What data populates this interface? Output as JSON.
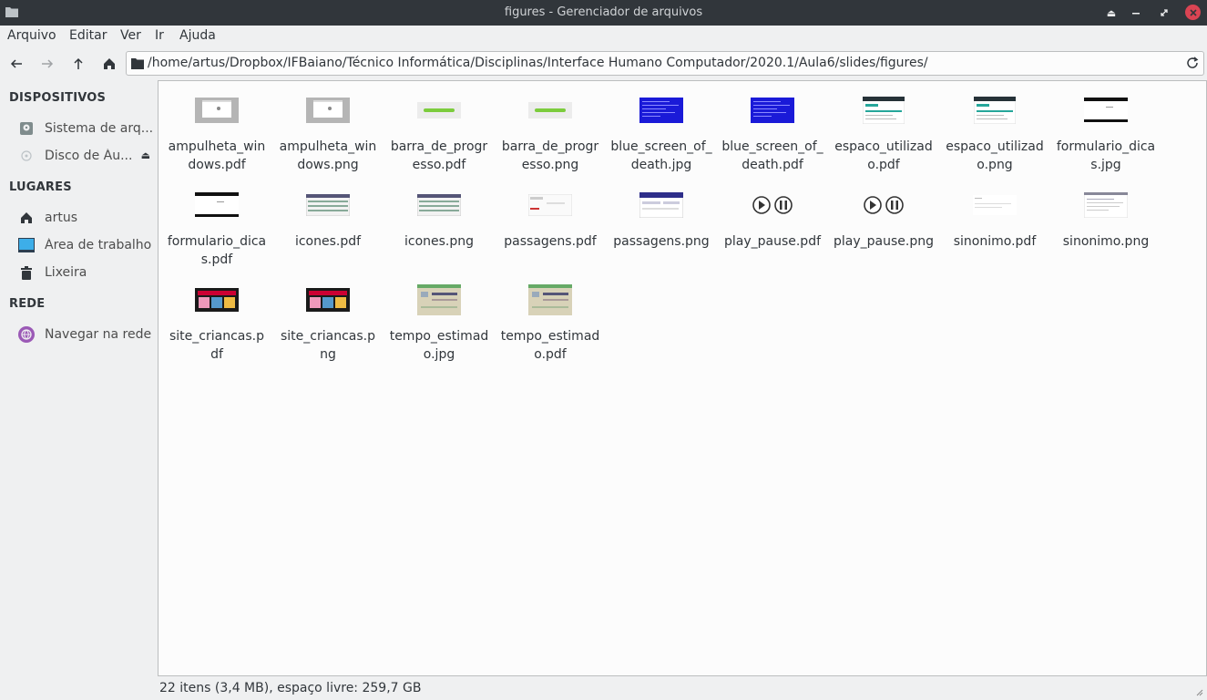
{
  "window": {
    "title": "figures - Gerenciador de arquivos",
    "controls": [
      "eject-icon",
      "minimize-icon",
      "maximize-icon",
      "close-icon"
    ]
  },
  "menubar": {
    "items": [
      "Arquivo",
      "Editar",
      "Ver",
      "Ir",
      "Ajuda"
    ]
  },
  "toolbar": {
    "buttons": [
      "back-arrow-icon",
      "forward-arrow-icon",
      "up-arrow-icon",
      "home-icon"
    ],
    "path": "/home/artus/Dropbox/IFBaiano/Técnico Informática/Disciplinas/Interface Humano Computador/2020.1/Aula6/slides/figures/"
  },
  "sidebar": {
    "sections": [
      {
        "title": "DISPOSITIVOS",
        "items": [
          {
            "label": "Sistema de arq...",
            "icon": "harddisk-icon"
          },
          {
            "label": "Disco de Áu...",
            "icon": "optical-disc-icon",
            "eject": true
          }
        ]
      },
      {
        "title": "LUGARES",
        "items": [
          {
            "label": "artus",
            "icon": "home-icon"
          },
          {
            "label": "Área de trabalho",
            "icon": "desktop-icon"
          },
          {
            "label": "Lixeira",
            "icon": "trash-icon"
          }
        ]
      },
      {
        "title": "REDE",
        "items": [
          {
            "label": "Navegar na rede",
            "icon": "network-icon"
          }
        ]
      }
    ]
  },
  "files": [
    {
      "name": "ampulheta_windows.pdf",
      "thumb": "hourglass"
    },
    {
      "name": "ampulheta_windows.png",
      "thumb": "hourglass"
    },
    {
      "name": "barra_de_progresso.pdf",
      "thumb": "progress"
    },
    {
      "name": "barra_de_progresso.png",
      "thumb": "progress"
    },
    {
      "name": "blue_screen_of_death.jpg",
      "thumb": "bsod"
    },
    {
      "name": "blue_screen_of_death.pdf",
      "thumb": "bsod"
    },
    {
      "name": "espaco_utilizado.pdf",
      "thumb": "storage"
    },
    {
      "name": "espaco_utilizado.png",
      "thumb": "storage"
    },
    {
      "name": "formulario_dicas.jpg",
      "thumb": "form"
    },
    {
      "name": "formulario_dicas.pdf",
      "thumb": "form"
    },
    {
      "name": "icones.pdf",
      "thumb": "icons"
    },
    {
      "name": "icones.png",
      "thumb": "icons"
    },
    {
      "name": "passagens.pdf",
      "thumb": "tickets-light"
    },
    {
      "name": "passagens.png",
      "thumb": "tickets"
    },
    {
      "name": "play_pause.pdf",
      "thumb": "playpause"
    },
    {
      "name": "play_pause.png",
      "thumb": "playpause"
    },
    {
      "name": "sinonimo.pdf",
      "thumb": "synonym-light"
    },
    {
      "name": "sinonimo.png",
      "thumb": "synonym"
    },
    {
      "name": "site_criancas.pdf",
      "thumb": "kids"
    },
    {
      "name": "site_criancas.png",
      "thumb": "kids"
    },
    {
      "name": "tempo_estimado.jpg",
      "thumb": "estimate"
    },
    {
      "name": "tempo_estimado.pdf",
      "thumb": "estimate"
    }
  ],
  "statusbar": {
    "text": "22 itens (3,4 MB), espaço livre: 259,7 GB"
  },
  "colors": {
    "accent": "#3daee9",
    "close": "#da4453",
    "titlebar": "#31363b",
    "network": "#9b59b6"
  }
}
